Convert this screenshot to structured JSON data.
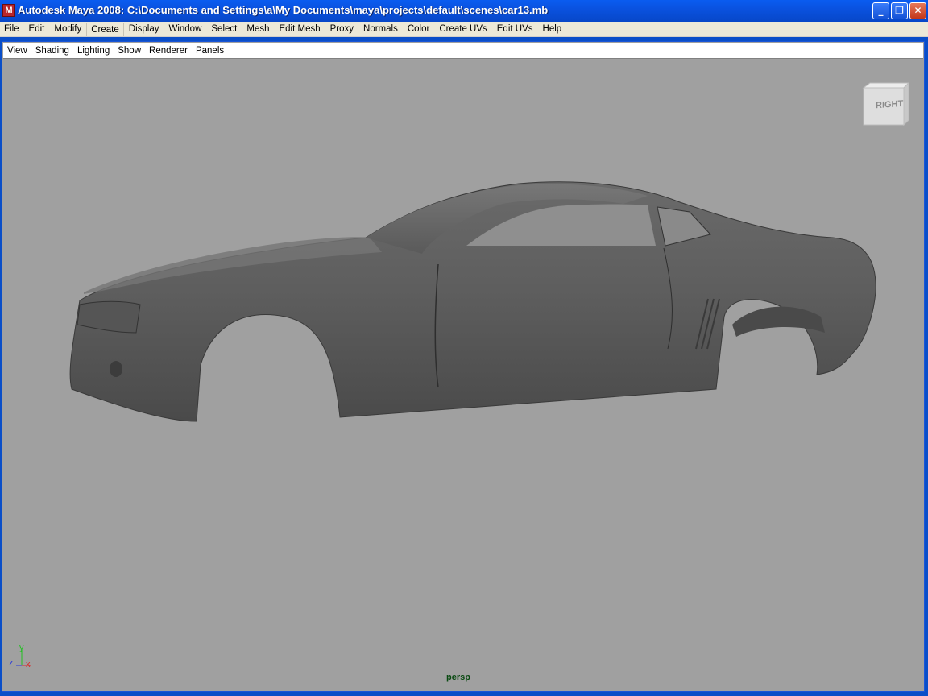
{
  "window": {
    "title": "Autodesk Maya 2008: C:\\Documents and Settings\\a\\My Documents\\maya\\projects\\default\\scenes\\car13.mb",
    "minimize_glyph": "_",
    "maximize_glyph": "❐",
    "close_glyph": "✕"
  },
  "menu": {
    "items": [
      "File",
      "Edit",
      "Modify",
      "Create",
      "Display",
      "Window",
      "Select",
      "Mesh",
      "Edit Mesh",
      "Proxy",
      "Normals",
      "Color",
      "Create UVs",
      "Edit UVs",
      "Help"
    ]
  },
  "panel_menu": {
    "items": [
      "View",
      "Shading",
      "Lighting",
      "Show",
      "Renderer",
      "Panels"
    ]
  },
  "viewport": {
    "camera_label": "persp",
    "viewcube_face": "RIGHT",
    "background_color": "#a0a0a0",
    "model_color": "#6e6e6e",
    "axis": {
      "y": "y",
      "z": "z",
      "x": "x",
      "y_color": "#22c022",
      "z_color": "#2a3ad8",
      "x_color": "#d82a2a"
    }
  }
}
